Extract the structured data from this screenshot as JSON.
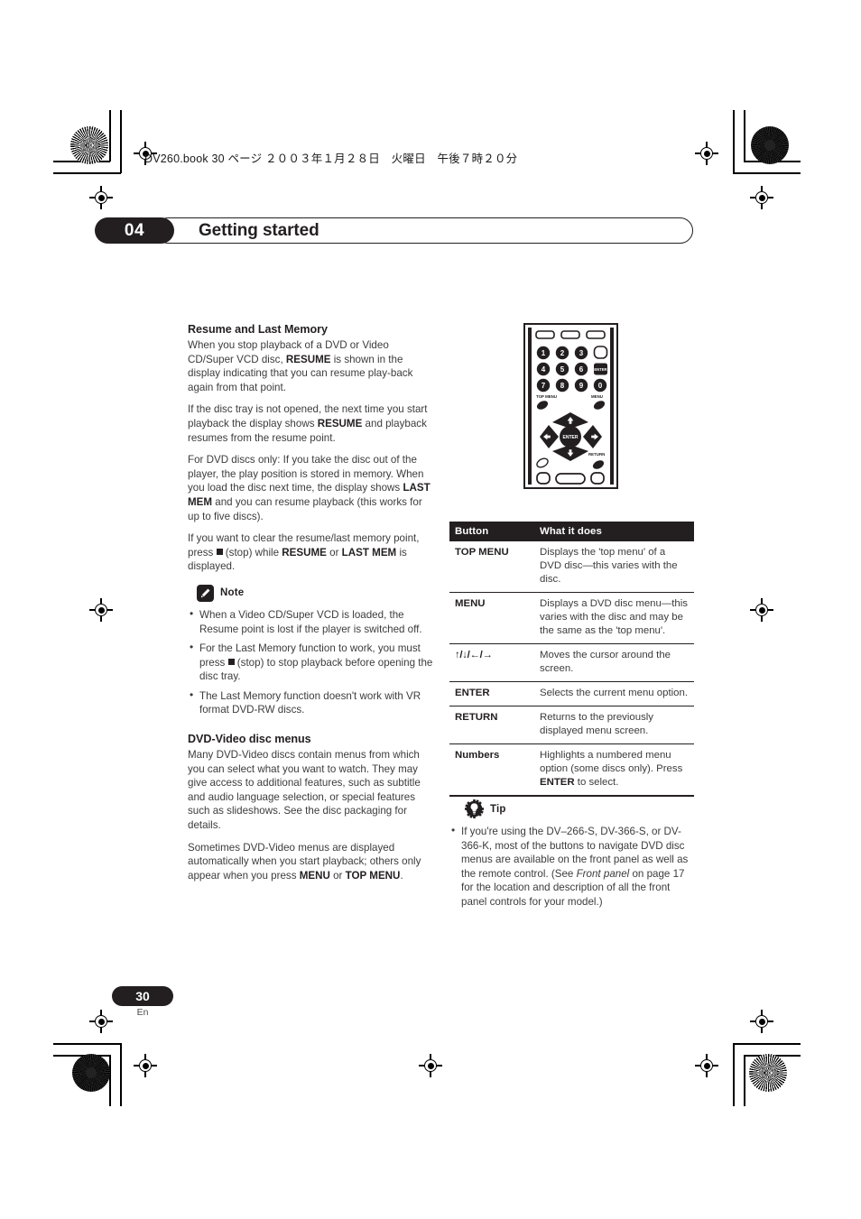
{
  "print_marks": {
    "slug_line": "DV260.book  30 ページ  ２００３年１月２８日　火曜日　午後７時２０分"
  },
  "header": {
    "chapter_number": "04",
    "chapter_title": "Getting started"
  },
  "footer": {
    "page_number": "30",
    "language_code": "En"
  },
  "left_column": {
    "section1": {
      "heading": "Resume and Last Memory",
      "p1_a": "When you stop playback of a DVD or Video CD/Super VCD disc, ",
      "p1_b": "RESUME",
      "p1_c": " is shown in the display indicating that you can resume play-back again from that point.",
      "p2_a": "If the disc tray is not opened, the next time you start playback the display shows ",
      "p2_b": "RESUME",
      "p2_c": " and playback resumes from the resume point.",
      "p3_a": "For DVD discs only: If you take the disc out of the player, the play position is stored in memory. When you load the disc next time, the display shows ",
      "p3_b": "LAST MEM",
      "p3_c": " and you can resume playback (this works for up to five discs).",
      "p4_a": "If you want to clear the resume/last memory point, press ",
      "p4_stop": " (stop) while ",
      "p4_b": "RESUME",
      "p4_or": " or ",
      "p4_c": "LAST MEM",
      "p4_d": " is displayed."
    },
    "note": {
      "icon": "pencil-icon",
      "label": "Note",
      "items": [
        "When a Video CD/Super VCD is loaded, the Resume point is lost if the player is switched off.",
        "The Last Memory function doesn't work with VR format DVD-RW discs."
      ],
      "item2_a": "For the Last Memory function to work, you must press ",
      "item2_b": " (stop) to stop playback before opening the disc tray."
    },
    "section2": {
      "heading": "DVD-Video disc menus",
      "p1": "Many DVD-Video discs contain menus from which you can select what you want to watch. They may give access to additional features, such as subtitle and audio language selection, or special features such as slideshows. See the disc packaging for details.",
      "p2_a": "Sometimes DVD-Video menus are displayed automatically when you start playback; others only appear when you press ",
      "p2_b": "MENU",
      "p2_or": " or ",
      "p2_c": "TOP MENU",
      "p2_d": "."
    }
  },
  "right_column": {
    "remote": {
      "alt": "remote-control-illustration",
      "number_keys": [
        "1",
        "2",
        "3",
        "4",
        "5",
        "6",
        "7",
        "8",
        "9",
        "0"
      ],
      "enter_key_label": "ENTER",
      "top_menu_label": "TOP MENU",
      "menu_label": "MENU",
      "return_label": "RETURN",
      "center_label": "ENTER"
    },
    "table": {
      "columns": [
        "Button",
        "What it does"
      ],
      "rows": [
        {
          "button": "TOP MENU",
          "description": "Displays the 'top menu' of a DVD disc—this varies with the disc."
        },
        {
          "button": "MENU",
          "description": "Displays a DVD disc menu—this varies with the disc and may be the same as the 'top menu'."
        },
        {
          "button": "↑/↓/←/→",
          "description": "Moves the cursor around the screen."
        },
        {
          "button": "ENTER",
          "description": "Selects the current menu option."
        },
        {
          "button": "RETURN",
          "description": "Returns to the previously displayed menu screen."
        },
        {
          "button": "Numbers",
          "description_a": "Highlights a numbered menu option (some discs only). Press ",
          "description_b": "ENTER",
          "description_c": " to select."
        }
      ]
    },
    "tip": {
      "icon": "gear-lightbulb-icon",
      "label": "Tip",
      "text_a": "If you're using the DV–266-S, DV-366-S, or DV-366-K, most of the buttons to navigate DVD disc menus are available on the front panel as well as the remote control. (See ",
      "text_italic": "Front panel",
      "text_b": " on page 17 for the location and description of all the front panel controls for your model.)"
    }
  },
  "colors": {
    "ink": "#231f20",
    "body_text": "#3c3c3c",
    "page_background": "#ffffff"
  }
}
